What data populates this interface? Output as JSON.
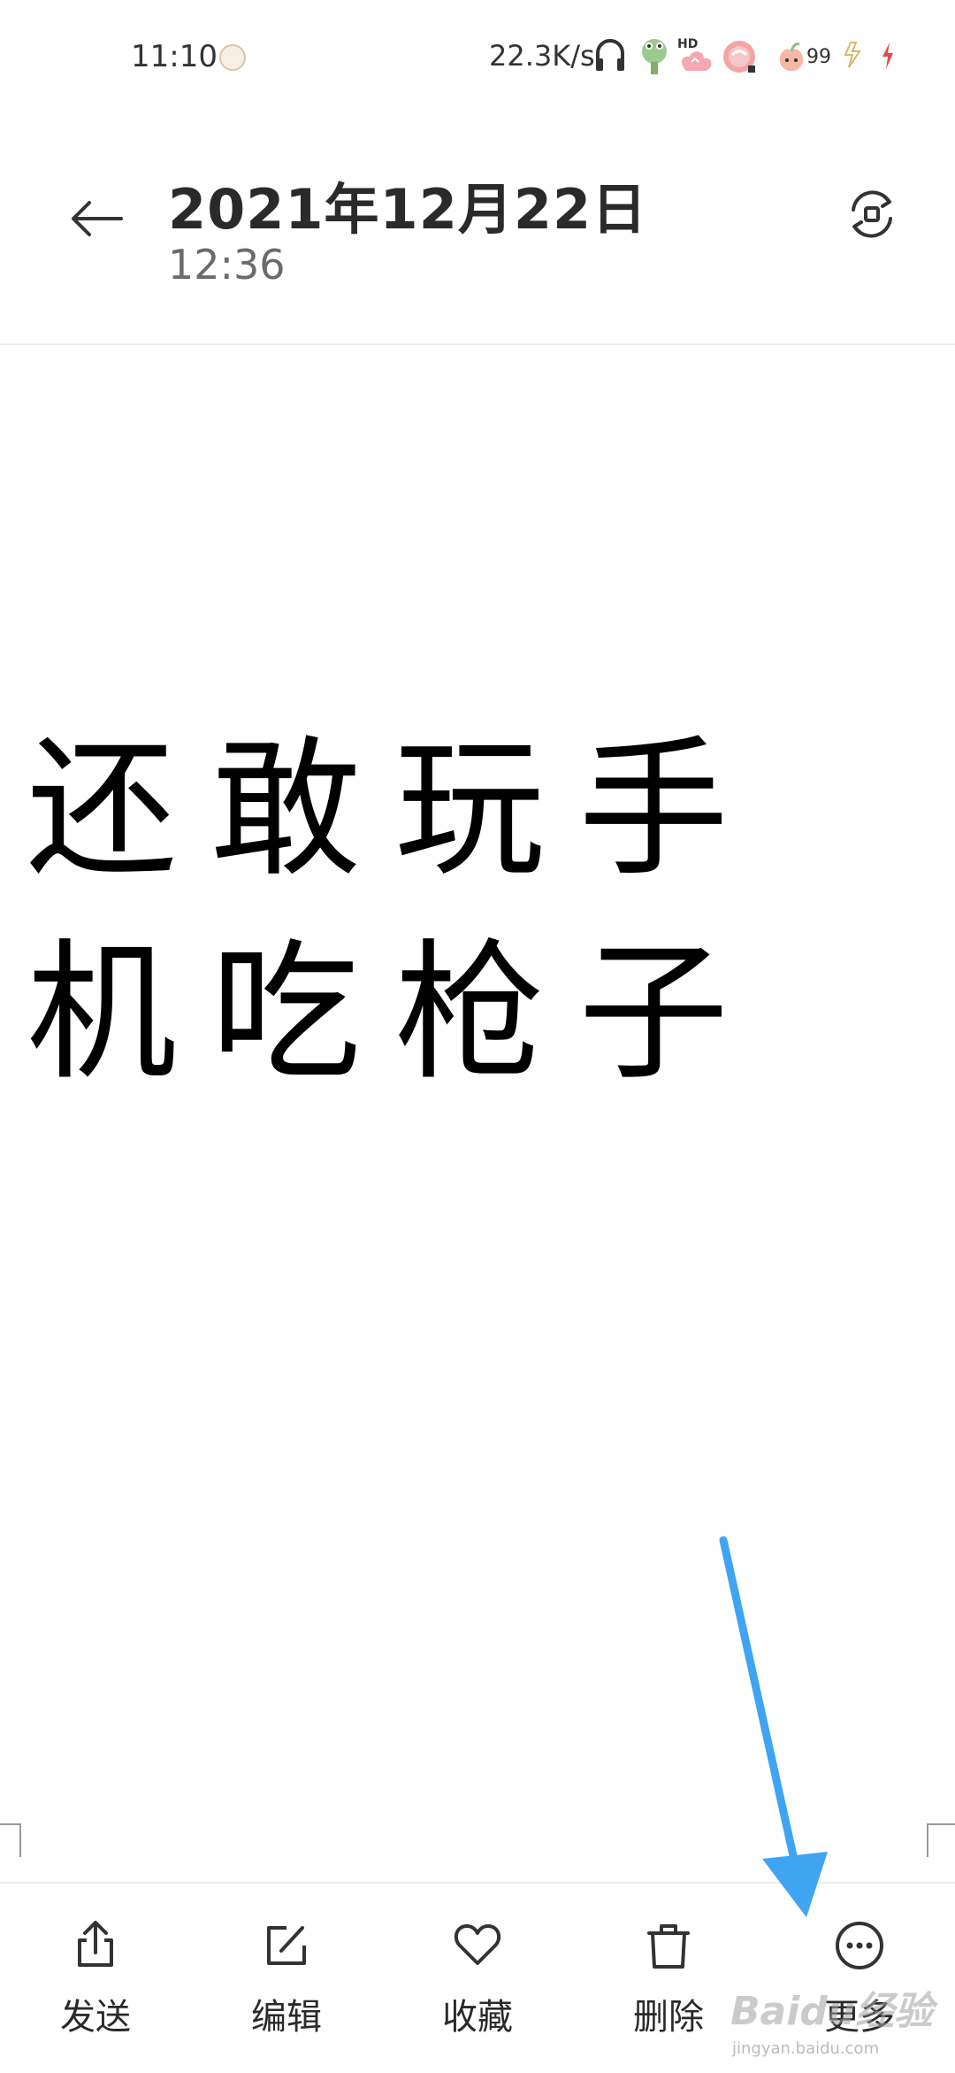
{
  "status_bar": {
    "time": "11:10",
    "network_speed": "22.3K/s",
    "battery_level": "99",
    "icons": [
      "face-icon",
      "headphones-icon",
      "frog-icon",
      "hd-signal-icon",
      "wifi-sticker-icon",
      "peach-battery-icon",
      "flash-icon",
      "charging-icon"
    ],
    "hd_label": "HD"
  },
  "header": {
    "date": "2021年12月22日",
    "time": "12:36",
    "back_icon": "arrow-left-icon",
    "rotate_icon": "rotate-icon"
  },
  "note": {
    "content": "还敢玩手机吃枪子"
  },
  "toolbar": {
    "items": [
      {
        "label": "发送",
        "icon": "share-icon"
      },
      {
        "label": "编辑",
        "icon": "edit-icon"
      },
      {
        "label": "收藏",
        "icon": "heart-icon"
      },
      {
        "label": "删除",
        "icon": "trash-icon"
      },
      {
        "label": "更多",
        "icon": "more-icon"
      }
    ]
  },
  "annotation": {
    "arrow_color": "#3fa4f2",
    "arrow_target": "更多"
  },
  "watermark": {
    "brand": "Baidu经验",
    "url": "jingyan.baidu.com"
  },
  "colors": {
    "text_primary": "#2a2a2a",
    "text_secondary": "#6b6b6b",
    "divider": "#ececec",
    "arrow": "#3fa4f2"
  }
}
